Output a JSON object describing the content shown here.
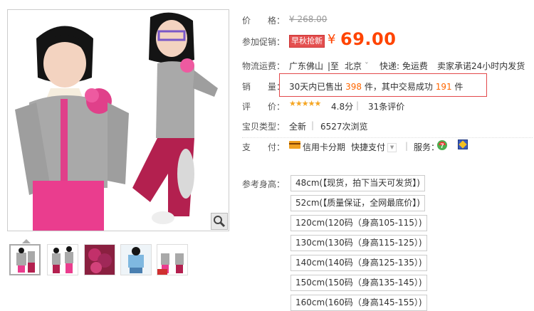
{
  "product": {
    "price_label": "价　　格：",
    "original_price": "¥ 268.00",
    "promo_label": "参加促销：",
    "promo_badge": "早秋抢新",
    "currency": "¥",
    "promo_price": "69.00",
    "shipping_label": "物流运费：",
    "ship_from": "广东佛山",
    "ship_to_sep": "|至",
    "ship_to": "北京",
    "ship_to_arrow": "ˇ",
    "express": "快递: 免运费",
    "promise": "卖家承诺24小时内发货",
    "sales_label": "销　　量：",
    "sold_prefix": "30天内已售出",
    "sold_count": "398",
    "sold_mid": "件，其中交易成功",
    "success_count": "191",
    "sold_suffix": "件",
    "rating_label": "评　　价：",
    "stars": "★★★★★",
    "rating_score": "4.8分",
    "review_count": "31条评价",
    "type_label": "宝贝类型：",
    "item_type": "全新",
    "views": "6527次浏览",
    "pay_label": "支　　付：",
    "pay_credit": "信用卡分期",
    "pay_quick": "快捷支付",
    "pay_more_arrow": "▼",
    "service_label": "服务：",
    "size_label": "参考身高：",
    "sizes": [
      "48cm(【现货，拍下当天可发货】)",
      "52cm(【质量保证，全网最底价】)",
      "120cm(120码（身高105-115）)",
      "130cm(130码（身高115-125）)",
      "140cm(140码（身高125-135）)",
      "150cm(150码（身高135-145）)",
      "160cm(160码（身高145-155）)"
    ]
  },
  "gallery": {
    "zoom_icon": "magnifier-icon",
    "thumbnail_count": 5,
    "active_thumbnail": 1
  },
  "colors": {
    "price_red": "#ff4400",
    "highlight_orange": "#ff6600",
    "box_red": "#e3494b",
    "badge_red": "#e45050",
    "star_gold": "#f5a623"
  }
}
